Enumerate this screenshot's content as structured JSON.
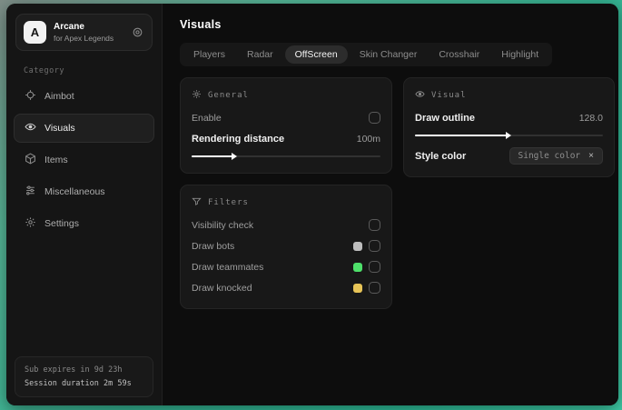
{
  "app": {
    "name": "Arcane",
    "subtitle": "for Apex Legends",
    "logo_letter": "A"
  },
  "sidebar": {
    "category_label": "Category",
    "items": [
      {
        "label": "Aimbot"
      },
      {
        "label": "Visuals"
      },
      {
        "label": "Items"
      },
      {
        "label": "Miscellaneous"
      },
      {
        "label": "Settings"
      }
    ],
    "footer": {
      "line1": "Sub expires in 9d 23h",
      "line2": "Session duration 2m 59s"
    }
  },
  "main": {
    "title": "Visuals",
    "active_tab": "OffScreen",
    "tabs": [
      {
        "label": "Players"
      },
      {
        "label": "Radar"
      },
      {
        "label": "OffScreen"
      },
      {
        "label": "Skin Changer"
      },
      {
        "label": "Crosshair"
      },
      {
        "label": "Highlight"
      }
    ]
  },
  "panels": {
    "general": {
      "title": "General",
      "enable_label": "Enable",
      "rendering_label": "Rendering distance",
      "rendering_value": "100m",
      "slider_fill": "width:23%"
    },
    "visual": {
      "title": "Visual",
      "outline_label": "Draw outline",
      "outline_value": "128.0",
      "slider_fill": "width:50%",
      "style_label": "Style color",
      "style_chip": "Single color",
      "chip_close": "×"
    },
    "filters": {
      "title": "Filters",
      "rows": [
        {
          "label": "Visibility check"
        },
        {
          "label": "Draw bots",
          "swatch": "background:#bdbdbd"
        },
        {
          "label": "Draw teammates",
          "swatch": "background:#4ee06a"
        },
        {
          "label": "Draw knocked",
          "swatch": "background:#e7c457"
        }
      ]
    }
  },
  "colors": {
    "backdrop_teal": "#35b392",
    "swatch_gray": "#bdbdbd",
    "swatch_green": "#4ee06a",
    "swatch_yellow": "#e7c457"
  }
}
